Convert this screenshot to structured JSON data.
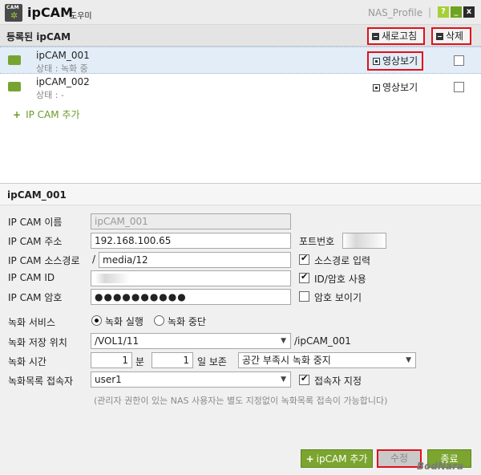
{
  "window": {
    "icon_label": "CAM",
    "title": "ipCAM",
    "subtitle": "도우미",
    "profile": "NAS_Profile",
    "separator": "|",
    "help": "?",
    "minimize": "_",
    "close": "x"
  },
  "list_header": {
    "title": "등록된 ipCAM",
    "refresh_label": "새로고침",
    "delete_label": "삭제"
  },
  "cameras": [
    {
      "name": "ipCAM_001",
      "status": "상태 : 녹화 중",
      "view_label": "영상보기",
      "checked": false
    },
    {
      "name": "ipCAM_002",
      "status": "상태 : -",
      "view_label": "영상보기",
      "checked": false
    }
  ],
  "add_link": {
    "plus": "+",
    "label": "IP CAM 추가"
  },
  "detail": {
    "title": "ipCAM_001",
    "name_label": "IP CAM 이름",
    "name_value": "ipCAM_001",
    "address_label": "IP CAM 주소",
    "address_value": "192.168.100.65",
    "port_label": "포트번호",
    "source_label": "IP CAM 소스경로",
    "source_prefix": "/",
    "source_value": "media/12",
    "source_input_label": "소스경로 입력",
    "id_label": "IP CAM ID",
    "id_pw_use_label": "ID/암호 사용",
    "pw_label": "IP CAM 암호",
    "pw_value": "●●●●●●●●●●",
    "pw_show_label": "암호 보이기",
    "rec_service_label": "녹화 서비스",
    "rec_run_label": "녹화 실행",
    "rec_stop_label": "녹화 중단",
    "rec_location_label": "녹화 저장 위치",
    "rec_location_value": "/VOL1/11",
    "rec_location_suffix": "/ipCAM_001",
    "rec_time_label": "녹화 시간",
    "minute_value": "1",
    "minute_unit": "분",
    "day_value": "1",
    "day_unit": "일 보존",
    "overflow_option": "공간 부족시 녹화 중지",
    "accessor_label": "녹화목록 접속자",
    "accessor_value": "user1",
    "accessor_assign_label": "접속자 지정",
    "note": "(관리자 권한이 있는 NAS 사용자는 별도 지정없이 녹화목록 접속이 가능합니다)"
  },
  "buttons": {
    "add_plus": "+",
    "add_label": "ipCAM 추가",
    "edit_label": "수정",
    "close_label": "종료"
  },
  "watermark": "BodNara",
  "colors": {
    "accent_green": "#7ba52e",
    "highlight_red": "#e0101a",
    "selection": "#e3edf8"
  }
}
